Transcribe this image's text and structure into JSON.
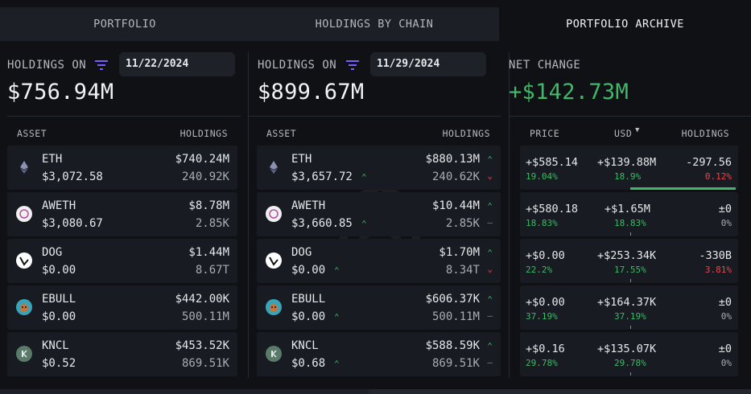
{
  "tabs": [
    "PORTFOLIO",
    "HOLDINGS BY CHAIN",
    "PORTFOLIO ARCHIVE"
  ],
  "left": {
    "label": "HOLDINGS ON",
    "date": "11/22/2024",
    "total": "$756.94M",
    "col_asset": "ASSET",
    "col_holdings": "HOLDINGS",
    "rows": [
      {
        "name": "ETH",
        "price": "$3,072.58",
        "usd": "$740.24M",
        "amt": "240.92K"
      },
      {
        "name": "AWETH",
        "price": "$3,080.67",
        "usd": "$8.78M",
        "amt": "2.85K"
      },
      {
        "name": "DOG",
        "price": "$0.00",
        "usd": "$1.44M",
        "amt": "8.67T"
      },
      {
        "name": "EBULL",
        "price": "$0.00",
        "usd": "$442.00K",
        "amt": "500.11M"
      },
      {
        "name": "KNCL",
        "price": "$0.52",
        "usd": "$453.52K",
        "amt": "869.51K"
      }
    ]
  },
  "middle": {
    "label": "HOLDINGS ON",
    "date": "11/29/2024",
    "total": "$899.67M",
    "col_asset": "ASSET",
    "col_holdings": "HOLDINGS",
    "rows": [
      {
        "name": "ETH",
        "price": "$3,657.72",
        "price_dir": "up",
        "usd": "$880.13M",
        "usd_dir": "up",
        "amt": "240.62K",
        "amt_dir": "down"
      },
      {
        "name": "AWETH",
        "price": "$3,660.85",
        "price_dir": "up",
        "usd": "$10.44M",
        "usd_dir": "up",
        "amt": "2.85K",
        "amt_dir": "flat"
      },
      {
        "name": "DOG",
        "price": "$0.00",
        "price_dir": "up",
        "usd": "$1.70M",
        "usd_dir": "up",
        "amt": "8.34T",
        "amt_dir": "down"
      },
      {
        "name": "EBULL",
        "price": "$0.00",
        "price_dir": "up",
        "usd": "$606.37K",
        "usd_dir": "up",
        "amt": "500.11M",
        "amt_dir": "flat"
      },
      {
        "name": "KNCL",
        "price": "$0.68",
        "price_dir": "up",
        "usd": "$588.59K",
        "usd_dir": "up",
        "amt": "869.51K",
        "amt_dir": "flat"
      }
    ]
  },
  "right": {
    "label": "NET CHANGE",
    "total": "+$142.73M",
    "col_price": "PRICE",
    "col_usd": "USD",
    "col_holdings": "HOLDINGS",
    "rows": [
      {
        "price": "+$585.14",
        "price_pct": "19.04%",
        "usd": "+$139.88M",
        "usd_pct": "18.9%",
        "hold": "-297.56",
        "hold_pct": "0.12%",
        "hold_pct_color": "red"
      },
      {
        "price": "+$580.18",
        "price_pct": "18.83%",
        "usd": "+$1.65M",
        "usd_pct": "18.83%",
        "hold": "±0",
        "hold_pct": "0%",
        "hold_pct_color": "grey"
      },
      {
        "price": "+$0.00",
        "price_pct": "22.2%",
        "usd": "+$253.34K",
        "usd_pct": "17.55%",
        "hold": "-330B",
        "hold_pct": "3.81%",
        "hold_pct_color": "red"
      },
      {
        "price": "+$0.00",
        "price_pct": "37.19%",
        "usd": "+$164.37K",
        "usd_pct": "37.19%",
        "hold": "±0",
        "hold_pct": "0%",
        "hold_pct_color": "grey"
      },
      {
        "price": "+$0.16",
        "price_pct": "29.78%",
        "usd": "+$135.07K",
        "usd_pct": "29.78%",
        "hold": "±0",
        "hold_pct": "0%",
        "hold_pct_color": "grey"
      }
    ]
  },
  "colors": {
    "up": "#3fb968",
    "down": "#e5484d",
    "accent": "#7c5cff"
  }
}
